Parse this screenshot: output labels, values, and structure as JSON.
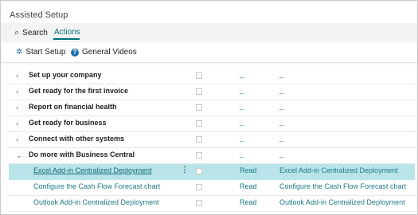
{
  "window": {
    "title": "Assisted Setup"
  },
  "toolbar": {
    "search_label": "Search",
    "actions_label": "Actions",
    "start_setup_label": "Start Setup",
    "general_videos_label": "General Videos"
  },
  "colors": {
    "accent": "#00707a",
    "selected_row": "#b9e5ea",
    "link": "#1c7a85"
  },
  "groups": [
    {
      "label": "Set up your company",
      "expanded": false,
      "status": "_",
      "help": "_"
    },
    {
      "label": "Get ready for the first invoice",
      "expanded": false,
      "status": "_",
      "help": "_"
    },
    {
      "label": "Report on financial health",
      "expanded": false,
      "status": "_",
      "help": "_"
    },
    {
      "label": "Get ready for business",
      "expanded": false,
      "status": "_",
      "help": "_"
    },
    {
      "label": "Connect with other systems",
      "expanded": false,
      "status": "_",
      "help": "_"
    },
    {
      "label": "Do more with Business Central",
      "expanded": true,
      "status": "_",
      "help": "_"
    }
  ],
  "items": [
    {
      "label": "Excel Add-in Centralized Deployment",
      "status": "Read",
      "help": "Excel Add-in Centralized Deployment",
      "selected": true
    },
    {
      "label": "Configure the Cash Flow Forecast chart",
      "status": "Read",
      "help": "Configure the Cash Flow Forecast chart",
      "selected": false
    },
    {
      "label": "Outlook Add-in Centralized Deployment",
      "status": "Read",
      "help": "Outlook Add-in Centralized Deployment",
      "selected": false
    }
  ],
  "icons": {
    "search": "magnifier-icon",
    "start": "wand-icon",
    "help": "help-circle-icon",
    "chevron_right": "chevron-right-icon",
    "chevron_down": "chevron-down-icon",
    "more": "more-vertical-icon"
  }
}
